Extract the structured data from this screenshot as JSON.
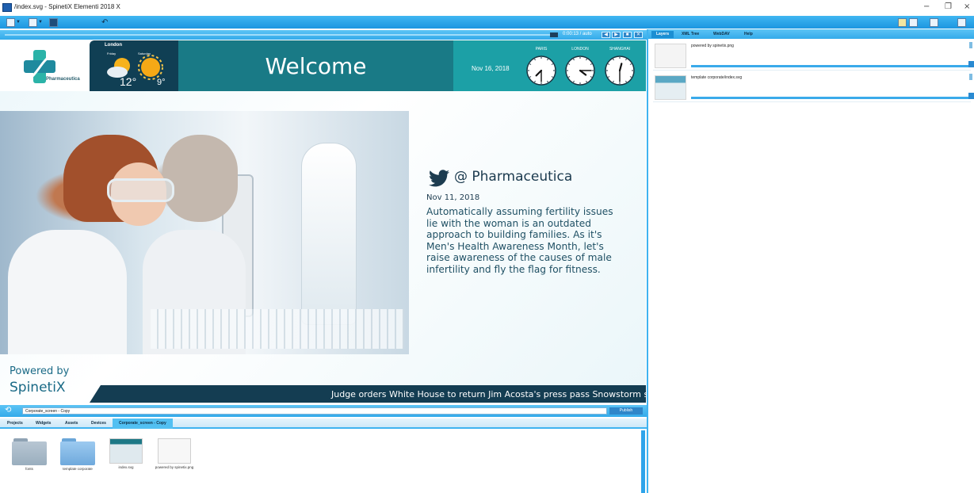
{
  "window": {
    "title": "/index.svg - SpinetiX Elementi 2018 X",
    "controls": [
      "−",
      "❐",
      "×"
    ]
  },
  "toolbar": {
    "icons": [
      "menu-icon",
      "new-file-icon",
      "save-icon",
      "undo-icon"
    ]
  },
  "preview": {
    "time_readout": "0:00:13 / auto",
    "controls": [
      "◀",
      "▶",
      "■",
      "✕"
    ]
  },
  "slide": {
    "logo_text": "Pharmaceutica",
    "weather": {
      "city": "London",
      "day1": "Friday",
      "day2": "Saturday",
      "temp1": "12°",
      "temp2": "9°"
    },
    "welcome": "Welcome",
    "date": "Nov 16, 2018",
    "clocks": [
      {
        "label": "PARIS",
        "hour": 7,
        "minute": 30
      },
      {
        "label": "LONDON",
        "hour": 4,
        "minute": 15
      },
      {
        "label": "SHANGHAI",
        "hour": 12,
        "minute": 30
      }
    ],
    "tweet": {
      "handle": "@ Pharmaceutica",
      "date": "Nov 11, 2018",
      "body": "Automatically assuming fertility issues lie with the woman is an outdated approach to building families. As it's Men's Health Awareness Month, let's raise awareness of the causes of male infertility and fly the flag for fitness."
    },
    "powered_by": "Powered by",
    "powered_brand": "SpinetiX",
    "ticker": "Judge orders White House to return Jim Acosta's press pass   Snowstorm slams eas"
  },
  "right_panel": {
    "tabs": [
      "Layers",
      "XML Tree",
      "WebDAV",
      "Help"
    ],
    "active_tab": "Layers",
    "layers": [
      {
        "name": "powered by spinetix.png"
      },
      {
        "name": "template corporate/index.svg"
      }
    ]
  },
  "bottom": {
    "path": "Corporate_screen - Copy",
    "publish": "Publish",
    "tabs": [
      "Projects",
      "Widgets",
      "Assets",
      "Devices",
      "Corporate_screen - Copy"
    ],
    "active_tab": "Corporate_screen - Copy",
    "files": [
      {
        "name": "fonts",
        "type": "folder"
      },
      {
        "name": "template corporate",
        "type": "folder-blue"
      },
      {
        "name": "index.svg",
        "type": "svg"
      },
      {
        "name": "powered by spinetix.png",
        "type": "png"
      }
    ]
  },
  "colors": {
    "accent": "#33aaea",
    "teal_dark": "#103f54",
    "teal": "#197a86",
    "teal_light": "#1ca0a6",
    "ticker_bg": "#143d52"
  }
}
